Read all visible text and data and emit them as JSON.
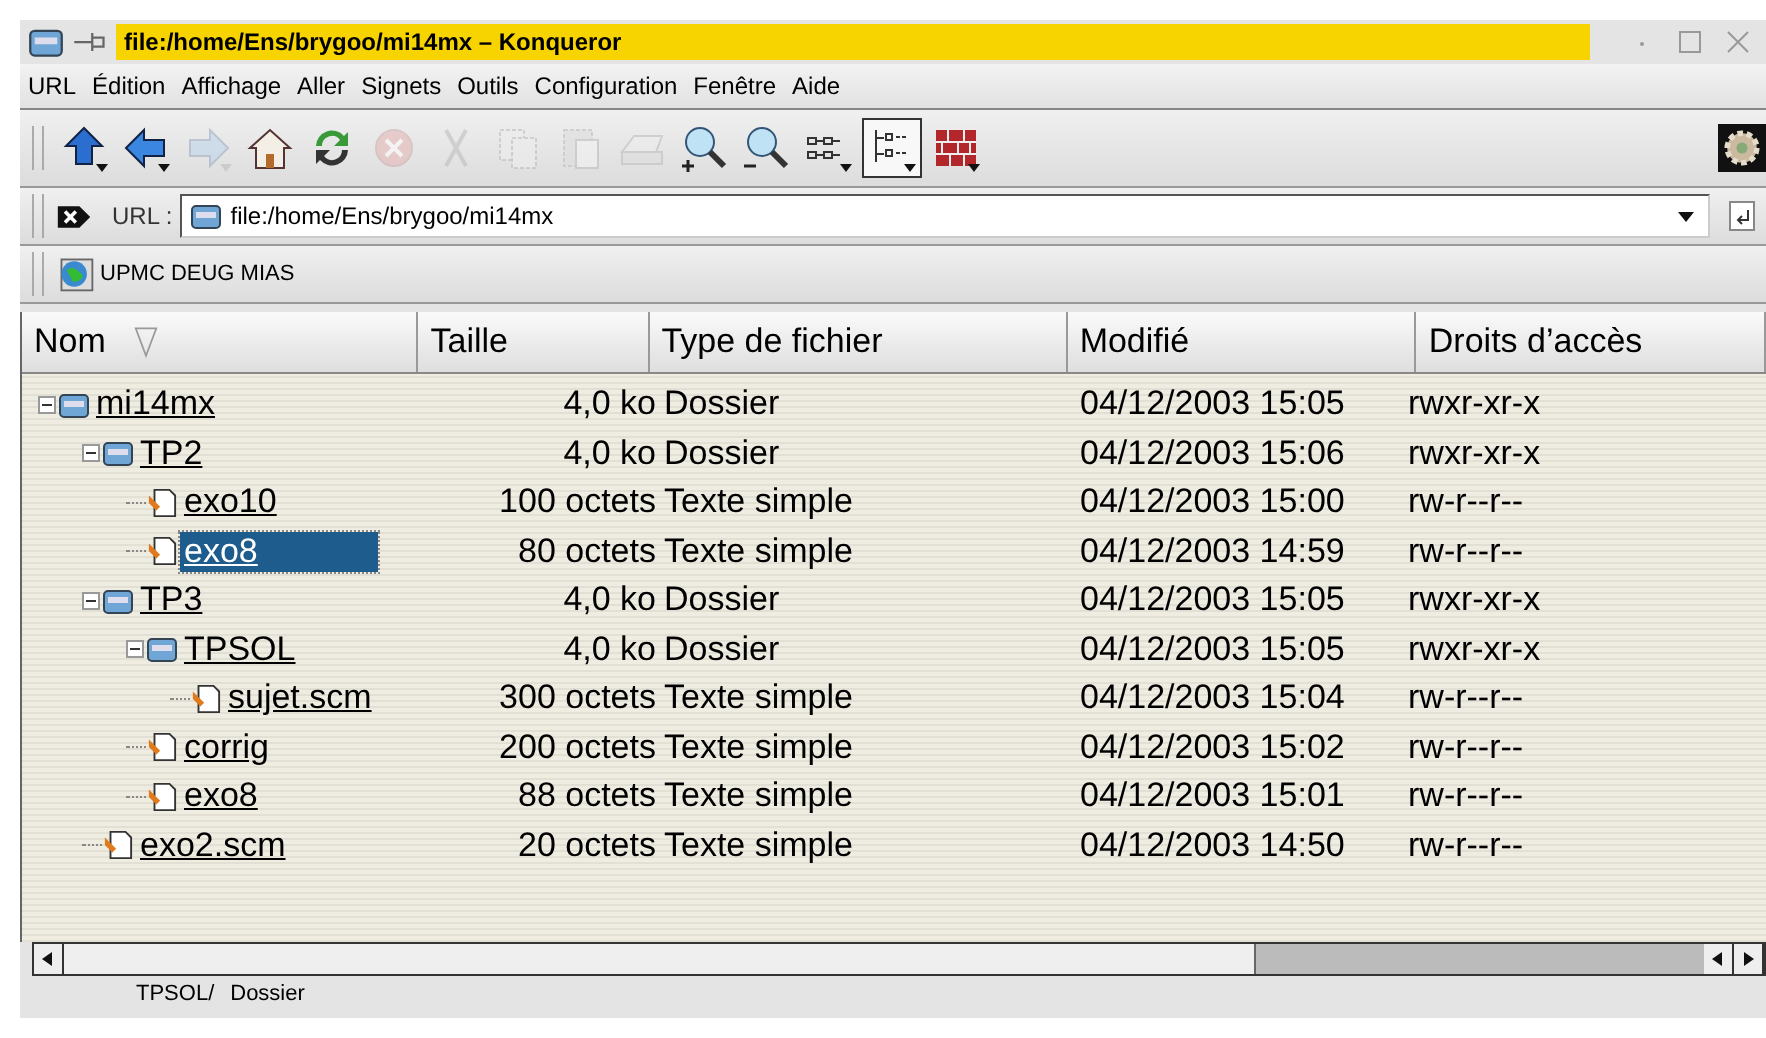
{
  "window": {
    "title": "file:/home/Ens/brygoo/mi14mx – Konqueror"
  },
  "menu": [
    "URL",
    "Édition",
    "Affichage",
    "Aller",
    "Signets",
    "Outils",
    "Configuration",
    "Fenêtre",
    "Aide"
  ],
  "toolbar": [
    {
      "kind": "up",
      "disabled": false,
      "menu": true
    },
    {
      "kind": "back",
      "disabled": false,
      "menu": true
    },
    {
      "kind": "forward",
      "disabled": true,
      "menu": true
    },
    {
      "kind": "home",
      "disabled": false,
      "menu": false
    },
    {
      "kind": "reload",
      "disabled": false,
      "menu": false
    },
    {
      "kind": "stop",
      "disabled": true,
      "menu": false
    },
    {
      "kind": "cut",
      "disabled": true,
      "menu": false
    },
    {
      "kind": "copy",
      "disabled": true,
      "menu": false
    },
    {
      "kind": "paste",
      "disabled": true,
      "menu": false
    },
    {
      "kind": "print",
      "disabled": true,
      "menu": false
    },
    {
      "kind": "zoomin",
      "disabled": false,
      "menu": false
    },
    {
      "kind": "zoomout",
      "disabled": false,
      "menu": false
    },
    {
      "kind": "iconview",
      "disabled": false,
      "menu": true
    },
    {
      "kind": "treeview",
      "disabled": false,
      "menu": true,
      "selected": true
    },
    {
      "kind": "firewall",
      "disabled": false,
      "menu": true
    }
  ],
  "location": {
    "label": "URL :",
    "value": "file:/home/Ens/brygoo/mi14mx"
  },
  "bookmarks": [
    "UPMC DEUG MIAS"
  ],
  "table": {
    "columns": [
      "Nom",
      "Taille",
      "Type de fichier",
      "Modifié",
      "Droits d’accès"
    ],
    "rows": [
      {
        "kind": "folder",
        "name": "mi14mx",
        "size": "4,0 ko",
        "type": "Dossier",
        "modified": "04/12/2003 15:05",
        "perms": "rwxr-xr-x",
        "selected": false,
        "expanded": true,
        "children": [
          {
            "kind": "folder",
            "name": "TP2",
            "size": "4,0 ko",
            "type": "Dossier",
            "modified": "04/12/2003 15:06",
            "perms": "rwxr-xr-x",
            "selected": false,
            "expanded": true,
            "children": [
              {
                "kind": "file",
                "name": "exo10",
                "size": "100 octets",
                "type": "Texte simple",
                "modified": "04/12/2003 15:00",
                "perms": "rw-r--r--",
                "selected": false
              },
              {
                "kind": "file",
                "name": "exo8",
                "size": "80 octets",
                "type": "Texte simple",
                "modified": "04/12/2003 14:59",
                "perms": "rw-r--r--",
                "selected": true
              }
            ]
          },
          {
            "kind": "folder",
            "name": "TP3",
            "size": "4,0 ko",
            "type": "Dossier",
            "modified": "04/12/2003 15:05",
            "perms": "rwxr-xr-x",
            "selected": false,
            "expanded": true,
            "children": [
              {
                "kind": "folder",
                "name": "TPSOL",
                "size": "4,0 ko",
                "type": "Dossier",
                "modified": "04/12/2003 15:05",
                "perms": "rwxr-xr-x",
                "selected": false,
                "expanded": true,
                "children": [
                  {
                    "kind": "file",
                    "name": "sujet.scm",
                    "size": "300 octets",
                    "type": "Texte simple",
                    "modified": "04/12/2003 15:04",
                    "perms": "rw-r--r--",
                    "selected": false
                  }
                ]
              },
              {
                "kind": "file",
                "name": "corrig",
                "size": "200 octets",
                "type": "Texte simple",
                "modified": "04/12/2003 15:02",
                "perms": "rw-r--r--",
                "selected": false
              },
              {
                "kind": "file",
                "name": "exo8",
                "size": "88 octets",
                "type": "Texte simple",
                "modified": "04/12/2003 15:01",
                "perms": "rw-r--r--",
                "selected": false
              }
            ]
          },
          {
            "kind": "file",
            "name": "exo2.scm",
            "size": "20 octets",
            "type": "Texte simple",
            "modified": "04/12/2003 14:50",
            "perms": "rw-r--r--",
            "selected": false
          }
        ]
      }
    ]
  },
  "status_bar": [
    "TPSOL/",
    "Dossier"
  ]
}
